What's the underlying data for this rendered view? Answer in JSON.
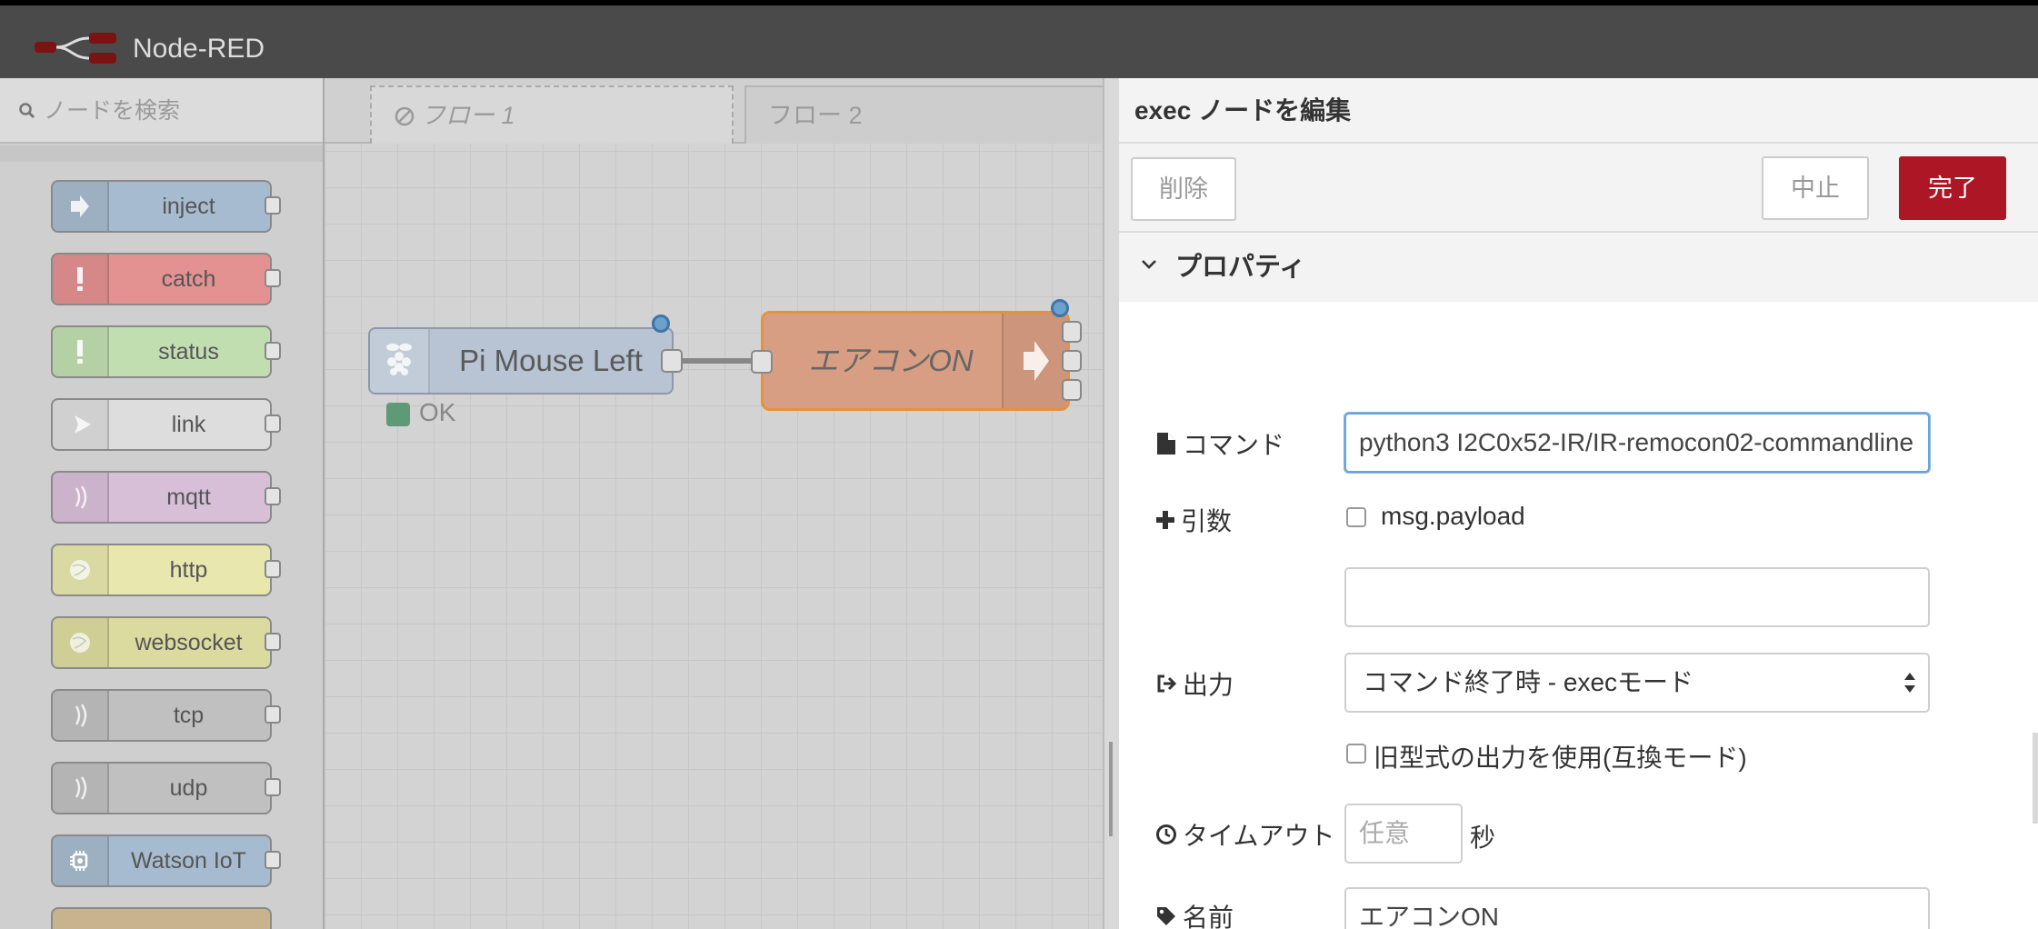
{
  "app": {
    "title": "Node-RED"
  },
  "palette": {
    "search_placeholder": "ノードを検索",
    "nodes": [
      {
        "label": "inject",
        "color": "#a6bbcf",
        "icon": "arrow-in-icon"
      },
      {
        "label": "catch",
        "color": "#e49191",
        "icon": "exclamation-icon"
      },
      {
        "label": "status",
        "color": "#c0deb0",
        "icon": "exclamation-icon"
      },
      {
        "label": "link",
        "color": "#dddddd",
        "icon": "link-arrow-icon"
      },
      {
        "label": "mqtt",
        "color": "#d8bfd8",
        "icon": "signal-wave-icon"
      },
      {
        "label": "http",
        "color": "#e7e7ae",
        "icon": "globe-icon"
      },
      {
        "label": "websocket",
        "color": "#dbdb9f",
        "icon": "globe-icon"
      },
      {
        "label": "tcp",
        "color": "#c0c0c0",
        "icon": "signal-wave-icon"
      },
      {
        "label": "udp",
        "color": "#c0c0c0",
        "icon": "signal-wave-icon"
      },
      {
        "label": "Watson IoT",
        "color": "#a6bbcf",
        "icon": "chip-icon"
      }
    ]
  },
  "workspace": {
    "tabs": [
      {
        "label": "フロー 1",
        "disabled": true
      },
      {
        "label": "フロー 2",
        "disabled": false
      }
    ],
    "nodes": {
      "pimouse": {
        "label": "Pi Mouse Left",
        "status": "OK",
        "status_color": "#5f9a78"
      },
      "aircon": {
        "label": "エアコンON"
      }
    }
  },
  "editor": {
    "title": "exec ノードを編集",
    "buttons": {
      "delete": "削除",
      "cancel": "中止",
      "done": "完了"
    },
    "section": "プロパティ",
    "fields": {
      "command_label": "コマンド",
      "command_value": "python3 I2C0x52-IR/IR-remocon02-commandline",
      "append_label": "引数",
      "append_payload_label": "msg.payload",
      "append_payload_checked": false,
      "append_value": "",
      "output_label": "出力",
      "output_value": "コマンド終了時 - execモード",
      "legacy_label": "旧型式の出力を使用(互換モード)",
      "legacy_checked": false,
      "timeout_label": "タイムアウト",
      "timeout_placeholder": "任意",
      "timeout_unit": "秒",
      "name_label": "名前",
      "name_value": "エアコンON"
    }
  }
}
